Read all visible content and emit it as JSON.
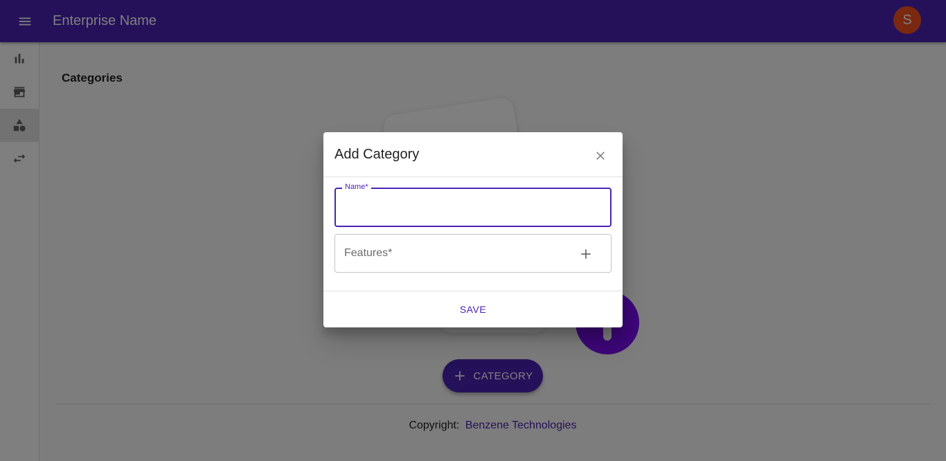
{
  "appbar": {
    "title": "Enterprise Name",
    "avatar_letter": "S",
    "accent": "#4a23b5",
    "avatar_color": "#f4511e"
  },
  "sidebar": {
    "items": [
      {
        "icon": "bar-chart-icon",
        "active": false
      },
      {
        "icon": "store-icon",
        "active": false
      },
      {
        "icon": "category-shapes-icon",
        "active": true
      },
      {
        "icon": "swap-arrows-icon",
        "active": false
      }
    ]
  },
  "main": {
    "page_title": "Categories",
    "fab_label": "CATEGORY",
    "footer": {
      "prefix": "Copyright:",
      "link": "Benzene Technologies"
    }
  },
  "dialog": {
    "title": "Add Category",
    "name_label": "Name*",
    "name_value": "",
    "features_placeholder": "Features*",
    "save_label": "SAVE"
  }
}
